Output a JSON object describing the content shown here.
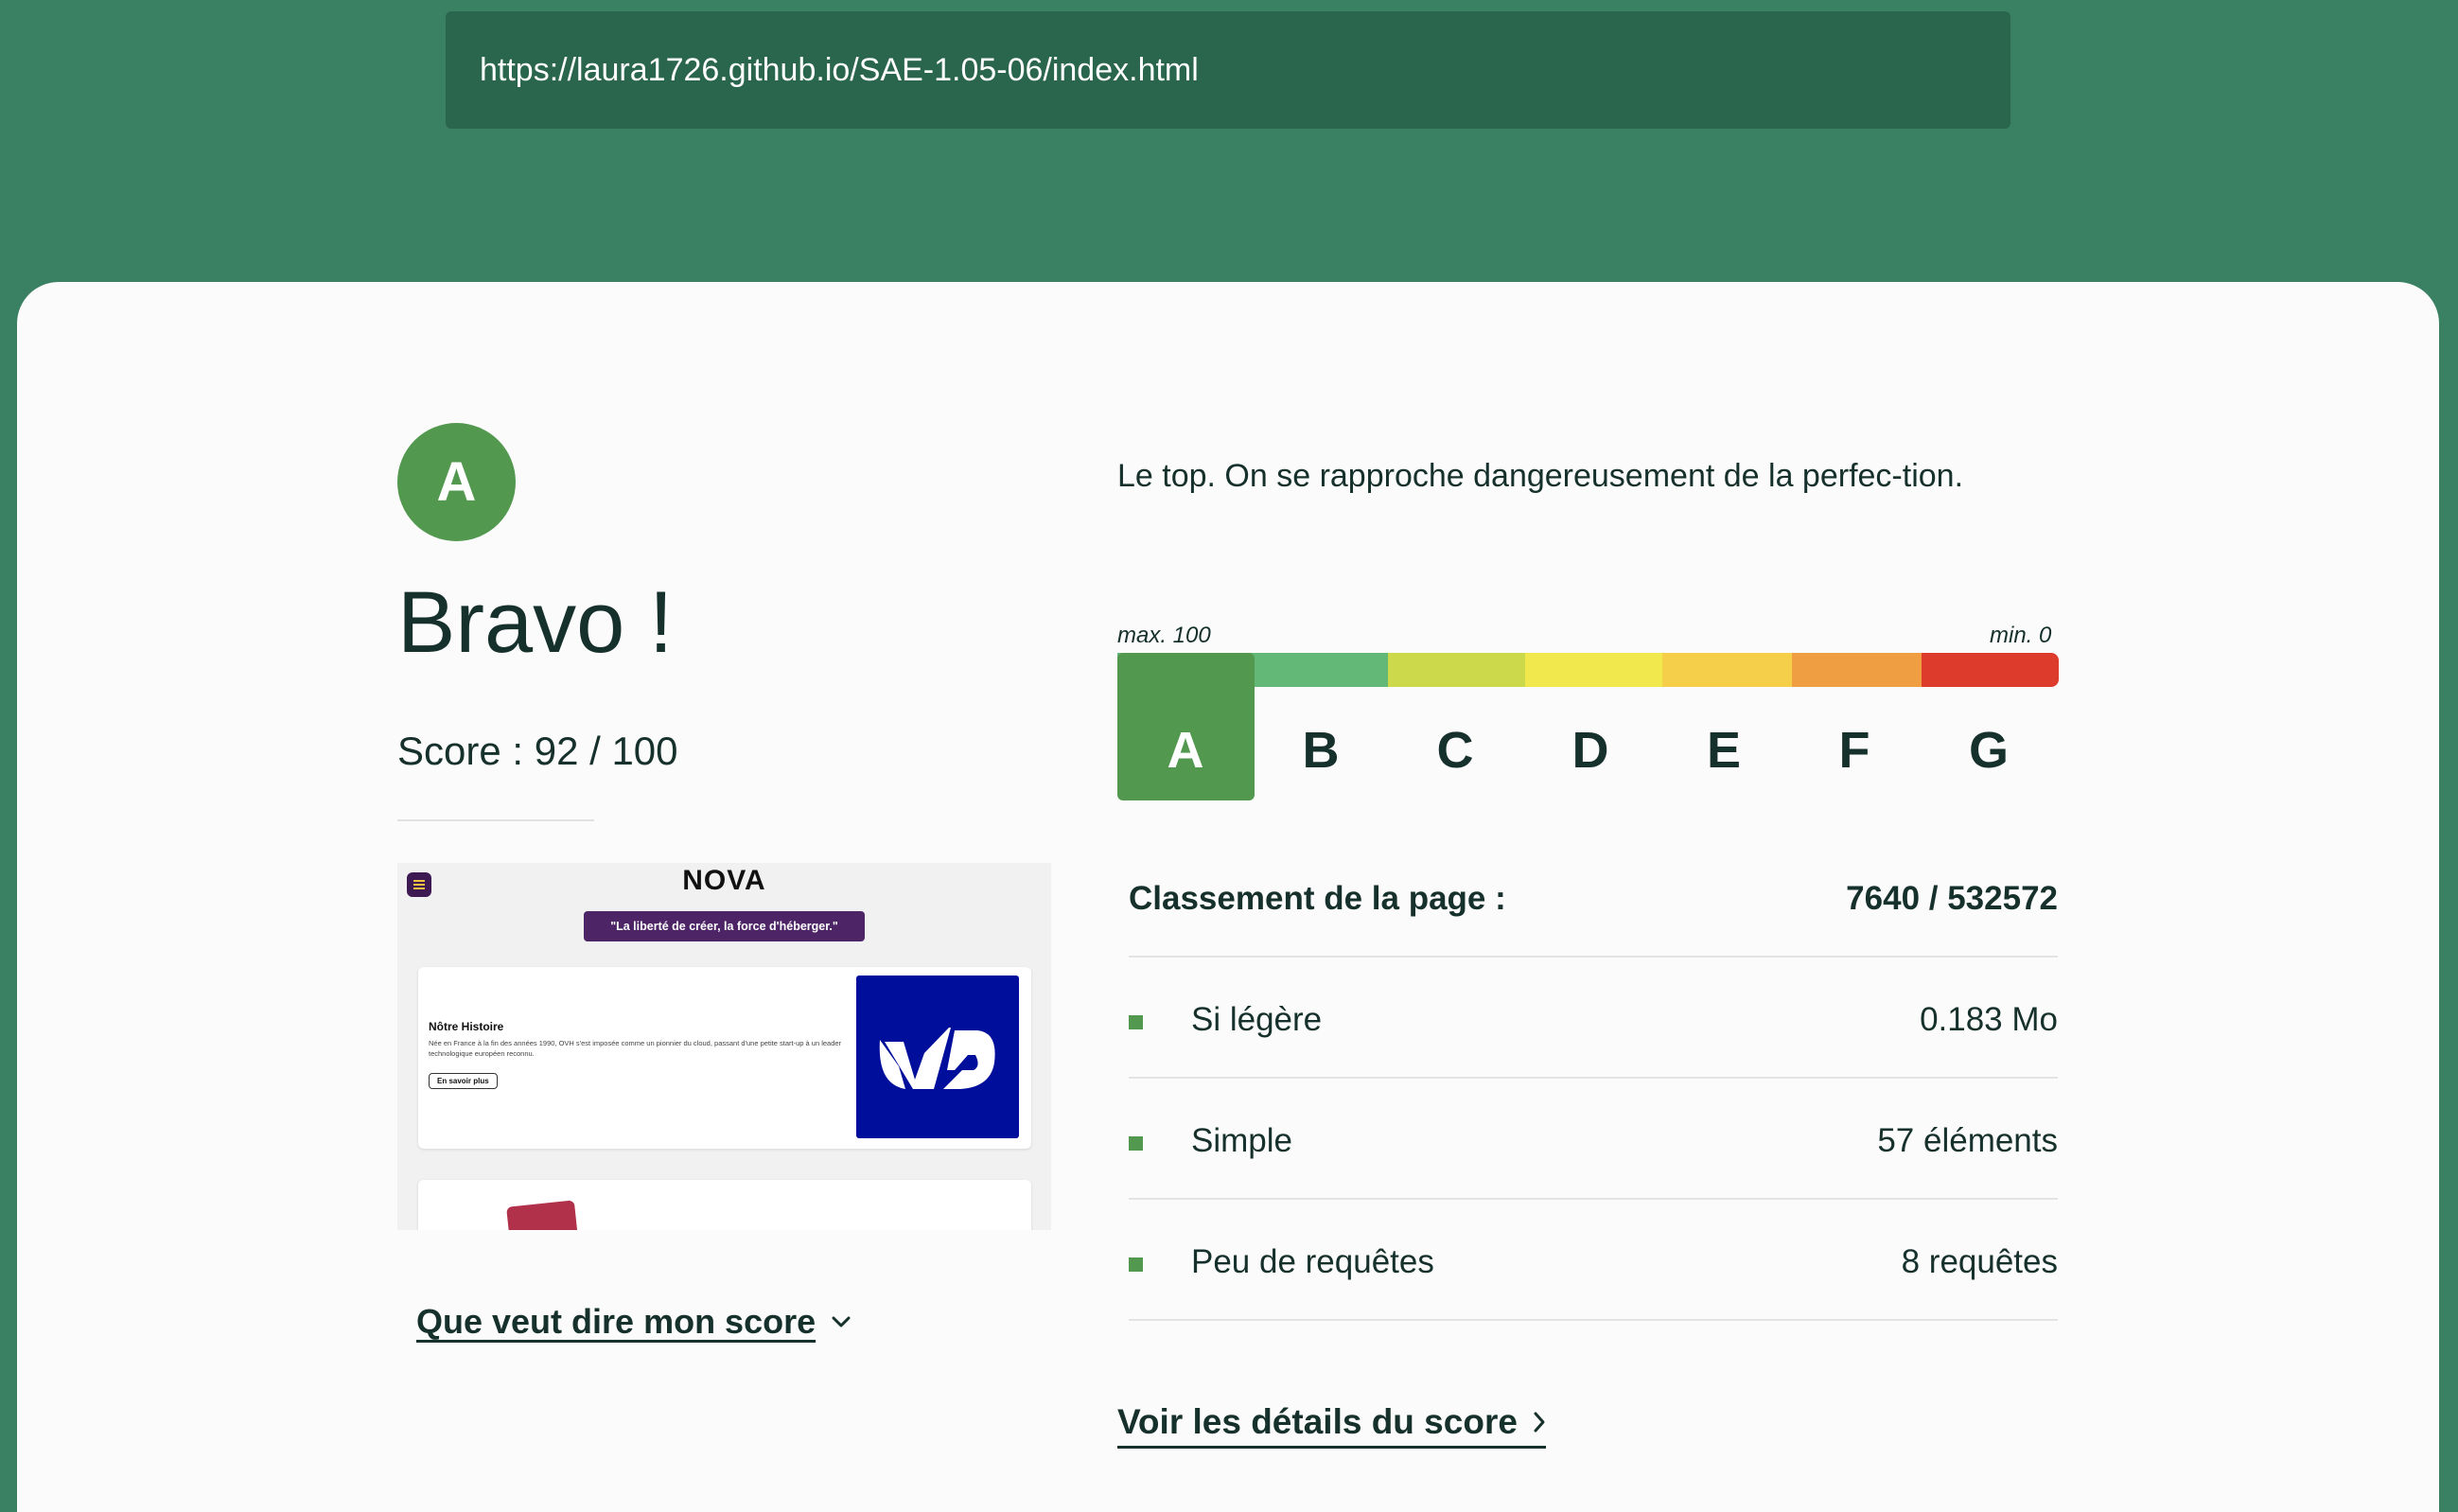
{
  "browser": {
    "url": "https://laura1726.github.io/SAE-1.05-06/index.html"
  },
  "result": {
    "grade": "A",
    "headline": "Bravo !",
    "score": "Score : 92 / 100",
    "description": "Le top. On se rapproche dangereusement de la perfec-tion.",
    "meaning_link": "Que veut dire mon score",
    "details_link": "Voir les détails du score"
  },
  "scale": {
    "max_label": "max. 100",
    "min_label": "min. 0",
    "current_level": "A",
    "levels": [
      {
        "letter": "A",
        "color": "#52984f"
      },
      {
        "letter": "B",
        "color": "#63b878"
      },
      {
        "letter": "C",
        "color": "#cbd94a"
      },
      {
        "letter": "D",
        "color": "#f1e84e"
      },
      {
        "letter": "E",
        "color": "#f6cf4a"
      },
      {
        "letter": "F",
        "color": "#ef9f42"
      },
      {
        "letter": "G",
        "color": "#dd3b2c"
      }
    ]
  },
  "ranking": {
    "label": "Classement de la page :",
    "value": "7640 / 532572"
  },
  "metrics": [
    {
      "label": "Si légère",
      "value": "0.183 Mo"
    },
    {
      "label": "Simple",
      "value": "57 éléments"
    },
    {
      "label": "Peu de requêtes",
      "value": "8 requêtes"
    }
  ],
  "preview": {
    "logo": "NOVA",
    "slogan": "\"La liberté de créer, la force d'héberger.\"",
    "section_title": "Nôtre Histoire",
    "section_text": "Née en France à la fin des années 1990, OVH s'est imposée comme un pionnier du cloud, passant d'une petite start-up à un leader technologique européen reconnu.",
    "section_button": "En savoir plus"
  },
  "colors": {
    "accent": "#52984f",
    "header_bg": "#3a8164",
    "urlbar_bg": "#2a654d",
    "text": "#16302b"
  }
}
